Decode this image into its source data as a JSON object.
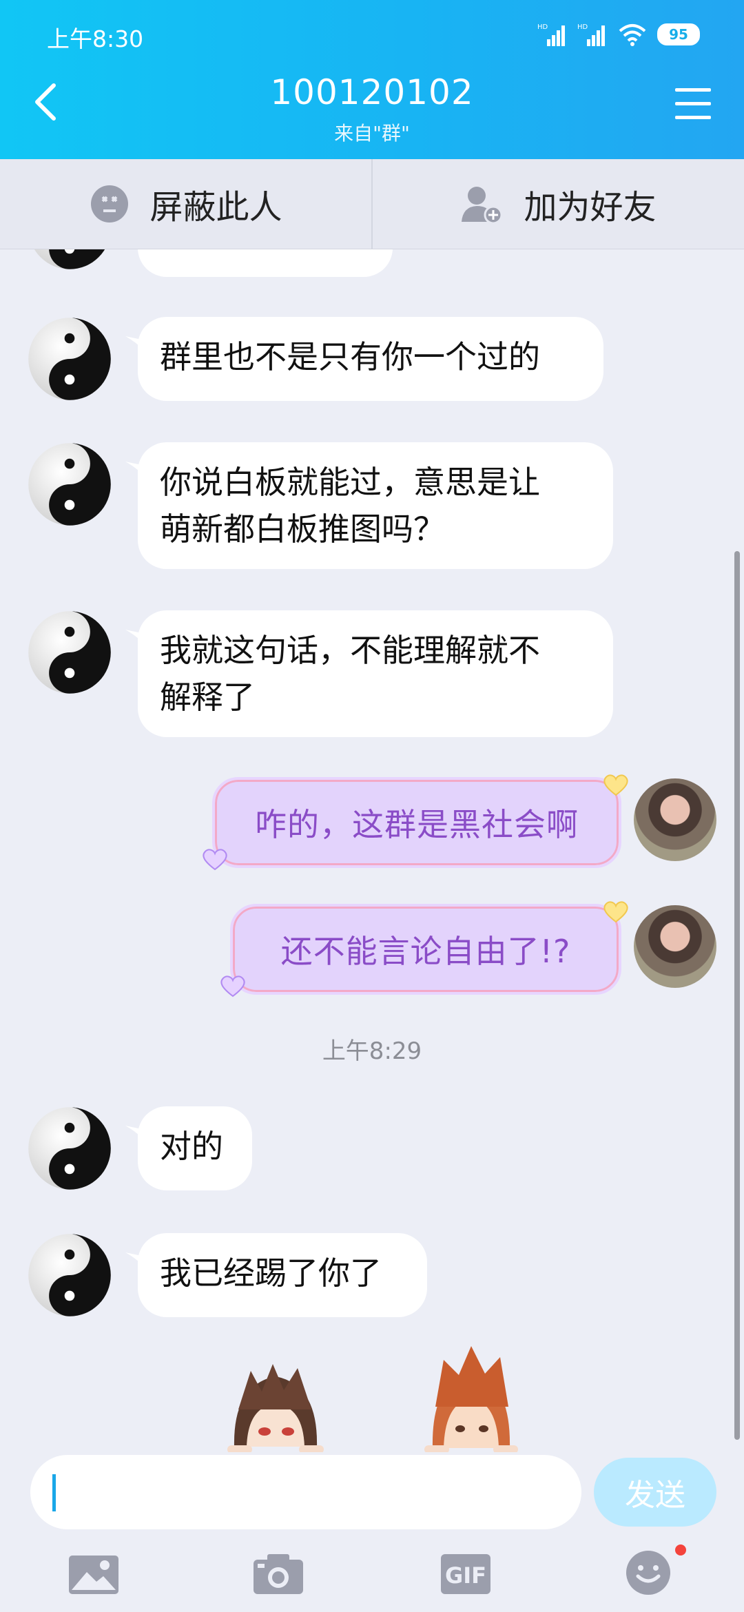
{
  "status_bar": {
    "time": "上午8:30",
    "signal1": "HD",
    "signal2": "HD",
    "battery": "95"
  },
  "header": {
    "title": "100120102",
    "subtitle": "来自\"群\""
  },
  "actions": {
    "block": "屏蔽此人",
    "add_friend": "加为好友"
  },
  "messages": [
    {
      "from": "other",
      "text": "群里也不是只有你一个过的"
    },
    {
      "from": "other",
      "lines": [
        "你说白板就能过，意思是让",
        "萌新都白板推图吗？"
      ]
    },
    {
      "from": "other",
      "lines": [
        "我就这句话，不能理解就不",
        "解释了"
      ]
    },
    {
      "from": "me",
      "text": "咋的，这群是黑社会啊"
    },
    {
      "from": "me",
      "text": "还不能言论自由了!?"
    },
    {
      "from": "other",
      "text": "对的"
    },
    {
      "from": "other",
      "text": "我已经踢了你了"
    }
  ],
  "timestamp": "上午8:29",
  "composer": {
    "value": "",
    "send_label": "发送"
  },
  "toolbar": {
    "gif_label": "GIF"
  },
  "colors": {
    "header": "#18b4f3",
    "my_bubble": "#e3d3fc",
    "my_text": "#8a4cc7",
    "send_disabled": "#baeaff"
  }
}
